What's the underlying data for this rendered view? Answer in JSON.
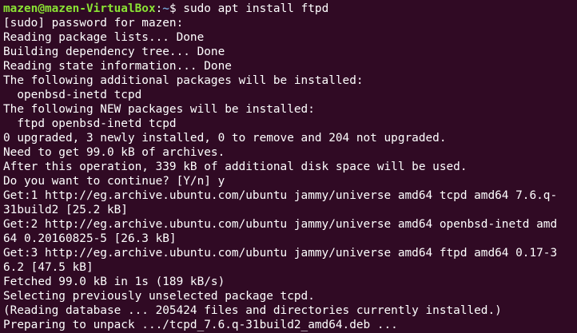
{
  "prompt": {
    "user_host": "mazen@mazen-VirtualBox",
    "separator": ":",
    "path": "~",
    "symbol": "$",
    "command": " sudo apt install ftpd"
  },
  "lines": [
    "[sudo] password for mazen:",
    "Reading package lists... Done",
    "Building dependency tree... Done",
    "Reading state information... Done",
    "The following additional packages will be installed:",
    "  openbsd-inetd tcpd",
    "The following NEW packages will be installed:",
    "  ftpd openbsd-inetd tcpd",
    "0 upgraded, 3 newly installed, 0 to remove and 204 not upgraded.",
    "Need to get 99.0 kB of archives.",
    "After this operation, 339 kB of additional disk space will be used.",
    "Do you want to continue? [Y/n] y",
    "Get:1 http://eg.archive.ubuntu.com/ubuntu jammy/universe amd64 tcpd amd64 7.6.q-",
    "31build2 [25.2 kB]",
    "Get:2 http://eg.archive.ubuntu.com/ubuntu jammy/universe amd64 openbsd-inetd amd",
    "64 0.20160825-5 [26.3 kB]",
    "Get:3 http://eg.archive.ubuntu.com/ubuntu jammy/universe amd64 ftpd amd64 0.17-3",
    "6.2 [47.5 kB]",
    "Fetched 99.0 kB in 1s (189 kB/s)",
    "Selecting previously unselected package tcpd.",
    "(Reading database ... 205424 files and directories currently installed.)",
    "Preparing to unpack .../tcpd_7.6.q-31build2_amd64.deb ..."
  ]
}
